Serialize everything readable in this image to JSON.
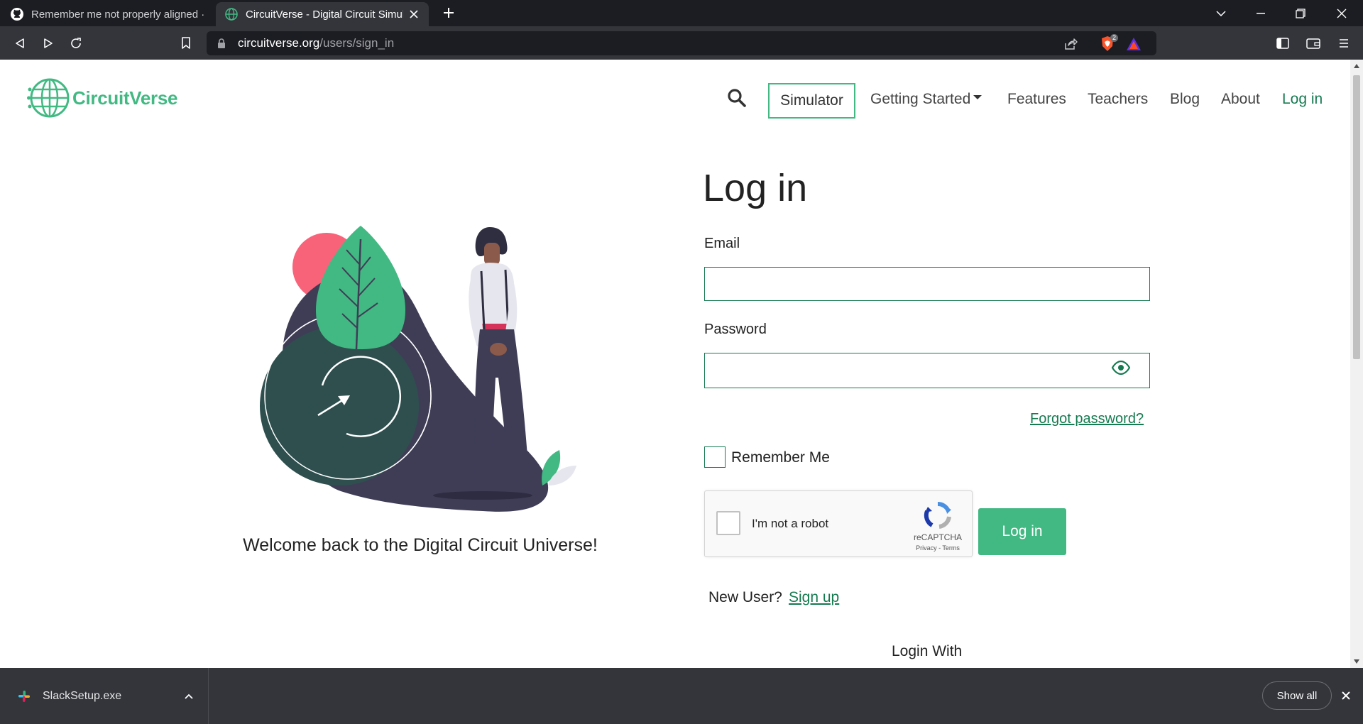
{
  "browser": {
    "tabs": [
      {
        "title": "Remember me not properly aligned · I",
        "icon": "github-icon",
        "active": false
      },
      {
        "title": "CircuitVerse - Digital Circuit Simul",
        "icon": "globe-icon",
        "active": true
      }
    ],
    "url": {
      "domain": "circuitverse.org",
      "path": "/users/sign_in"
    },
    "shield_count": "2"
  },
  "site": {
    "logo_text": "CircuitVerse",
    "brand_color": "#42b983",
    "link_color": "#157a50",
    "nav": {
      "simulator": "Simulator",
      "getting_started": "Getting Started",
      "features": "Features",
      "teachers": "Teachers",
      "blog": "Blog",
      "about": "About",
      "login": "Log in"
    }
  },
  "illustration": {
    "welcome_text": "Welcome back to the Digital Circuit Universe!"
  },
  "form": {
    "title": "Log in",
    "email_label": "Email",
    "email_value": "",
    "password_label": "Password",
    "password_value": "",
    "forgot_password": "Forgot password?",
    "remember_me": "Remember Me",
    "remember_checked": false,
    "captcha": {
      "label": "I'm not a robot",
      "brand": "reCAPTCHA",
      "links": "Privacy - Terms"
    },
    "submit": "Log in",
    "new_user": "New User?",
    "sign_up": "Sign up",
    "login_with": "Login With"
  },
  "downloads": {
    "file": "SlackSetup.exe",
    "show_all": "Show all"
  }
}
